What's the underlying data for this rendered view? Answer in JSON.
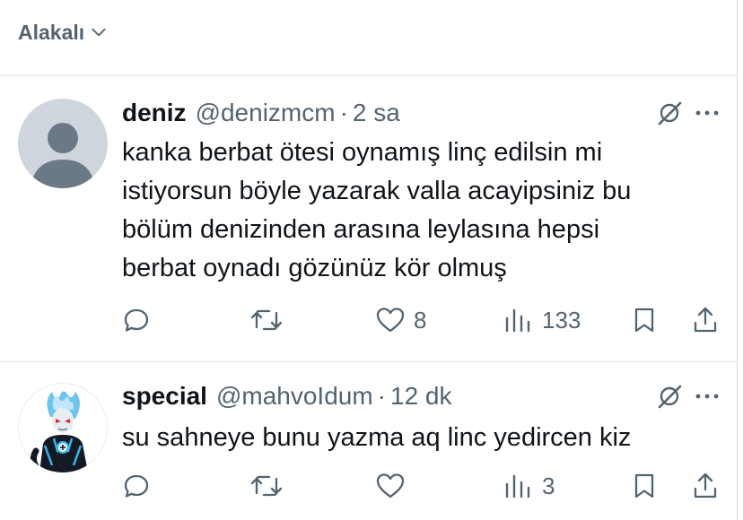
{
  "sort": {
    "label": "Alakalı",
    "icon": "chevron-down-icon"
  },
  "tweets": [
    {
      "name": "deniz",
      "handle": "@denizmcm",
      "separator": "·",
      "time": "2 sa",
      "lines": [
        "kanka berbat ötesi oynamış linç edilsin mi",
        "istiyorsun böyle yazarak valla acayipsiniz bu",
        "bölüm denizinden arasına leylasına hepsi",
        "berbat oynadı gözünüz kör olmuş"
      ],
      "likes": "8",
      "views": "133",
      "avatar": "default-avatar"
    },
    {
      "name": "special",
      "handle": "@mahvoIdum",
      "separator": "·",
      "time": "12 dk",
      "lines": [
        "su sahneye bunu yazma aq linc yedircen kiz"
      ],
      "likes": "",
      "views": "3",
      "avatar": "cartoon-alien-avatar"
    }
  ],
  "colors": {
    "text": "#0f1419",
    "secondary": "#536471",
    "divider": "#dfe4e8",
    "avatar_bg": "#ced5dc",
    "avatar_fg": "#6b7886"
  }
}
